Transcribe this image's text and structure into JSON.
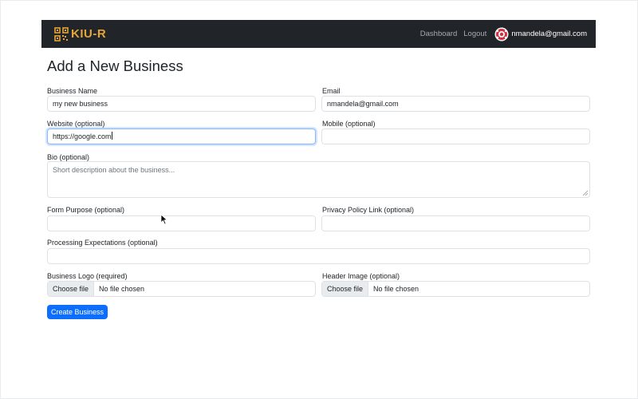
{
  "navbar": {
    "brand": "KIU-R",
    "brand_icon": "qr-code-icon",
    "brand_color": "#e6a537",
    "links": [
      "Dashboard",
      "Logout"
    ],
    "user_email": "nmandela@gmail.com",
    "avatar_icon": "avatar-icon"
  },
  "page": {
    "title": "Add a New Business"
  },
  "form": {
    "business_name": {
      "label": "Business Name",
      "value": "my new business"
    },
    "email": {
      "label": "Email",
      "value": "nmandela@gmail.com"
    },
    "website": {
      "label": "Website (optional)",
      "value": "https://google.com"
    },
    "mobile": {
      "label": "Mobile (optional)",
      "value": ""
    },
    "bio": {
      "label": "Bio (optional)",
      "placeholder": "Short description about the business..."
    },
    "form_purpose": {
      "label": "Form Purpose (optional)",
      "value": ""
    },
    "privacy_link": {
      "label": "Privacy Policy Link (optional)",
      "value": ""
    },
    "processing": {
      "label": "Processing Expectations (optional)",
      "value": ""
    },
    "logo": {
      "label": "Business Logo (required)",
      "button": "Choose file",
      "status": "No file chosen"
    },
    "header_image": {
      "label": "Header Image (optional)",
      "button": "Choose file",
      "status": "No file chosen"
    },
    "submit_label": "Create Business"
  },
  "colors": {
    "navbar_bg": "#212529",
    "primary": "#0d6efd",
    "focus_border": "#86b7fe"
  }
}
